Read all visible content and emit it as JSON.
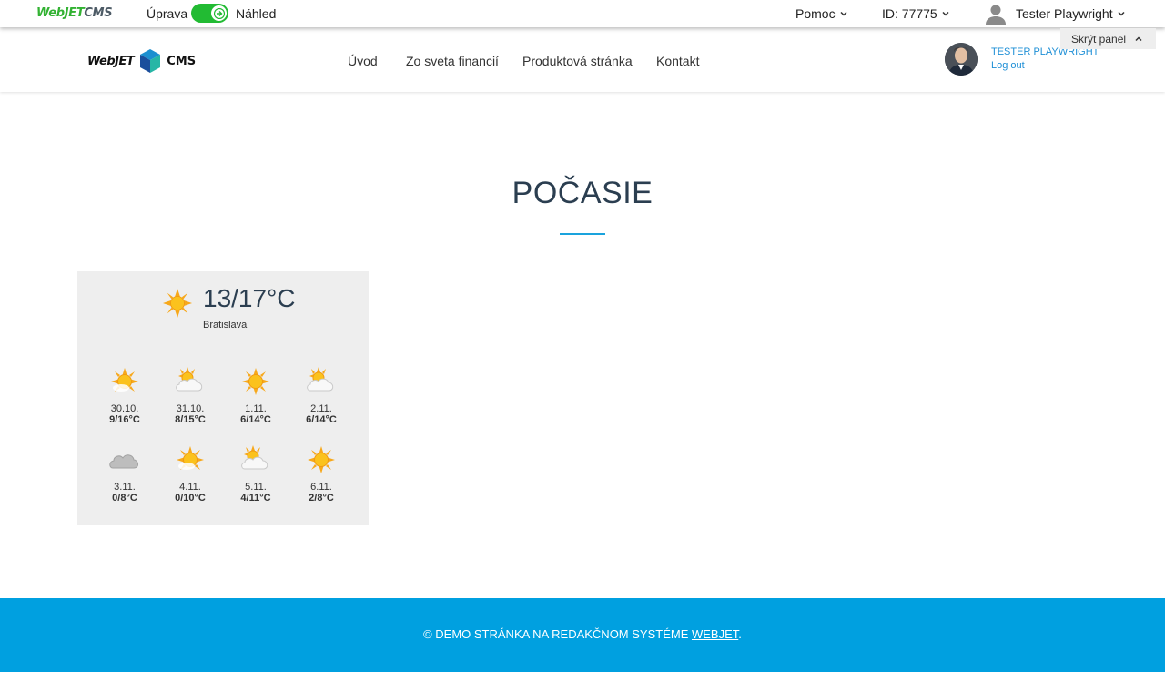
{
  "adminbar": {
    "brand_part1": "WebJET",
    "brand_part2": "CMS",
    "edit_label": "Úprava",
    "preview_label": "Náhled",
    "help_label": "Pomoc",
    "id_label": "ID: 77775",
    "user_name": "Tester Playwright"
  },
  "header": {
    "logo_left": "WebJET",
    "logo_right": "CMS",
    "nav": [
      "Úvod",
      "Zo sveta financií",
      "Produktová stránka",
      "Kontakt"
    ],
    "profile_name": "TESTER PLAYWRIGHT",
    "logout": "Log out",
    "hide_panel": "Skrýt panel"
  },
  "main": {
    "title": "POČASIE"
  },
  "weather": {
    "today_temp": "13/17°C",
    "city": "Bratislava",
    "today_icon": "sun-icon",
    "days": [
      {
        "date": "30.10.",
        "temp": "9/16°C",
        "icon": "sun-partly-cloudy-icon"
      },
      {
        "date": "31.10.",
        "temp": "8/15°C",
        "icon": "cloud-sun-icon"
      },
      {
        "date": "1.11.",
        "temp": "6/14°C",
        "icon": "sun-icon"
      },
      {
        "date": "2.11.",
        "temp": "6/14°C",
        "icon": "cloud-sun-icon"
      },
      {
        "date": "3.11.",
        "temp": "0/8°C",
        "icon": "cloud-icon"
      },
      {
        "date": "4.11.",
        "temp": "0/10°C",
        "icon": "sun-partly-cloudy-icon"
      },
      {
        "date": "5.11.",
        "temp": "4/11°C",
        "icon": "cloud-sun-icon"
      },
      {
        "date": "6.11.",
        "temp": "2/8°C",
        "icon": "sun-icon"
      }
    ]
  },
  "footer": {
    "text": "© DEMO STRÁNKA NA REDAKČNOM SYSTÉME ",
    "link": "WEBJET",
    "suffix": "."
  },
  "colors": {
    "accent": "#00a0e0",
    "toggle": "#22bb33",
    "link": "#1e8fd6",
    "title": "#2b3e50"
  }
}
